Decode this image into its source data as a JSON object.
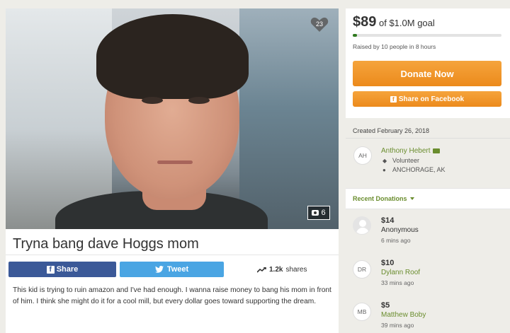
{
  "campaign": {
    "title": "Tryna bang dave Hoggs mom",
    "hearts": "23",
    "photo_count": "6",
    "story": "This kid is trying to ruin amazon and I've had enough. I wanna raise money to bang his mom in front of him. I think she might do it for a cool mill, but every dollar goes toward supporting the dream."
  },
  "share": {
    "facebook_label": "Share",
    "twitter_label": "Tweet",
    "shares_count": "1.2k",
    "shares_label": "shares"
  },
  "goal": {
    "raised": "$89",
    "goal_text": "of $1.0M goal",
    "raised_by": "Raised by 10 people in 8 hours",
    "progress_percent": 3,
    "donate_label": "Donate Now",
    "fb_share_label": "Share on Facebook"
  },
  "organizer": {
    "created": "Created February 26, 2018",
    "initials": "AH",
    "name": "Anthony Hebert",
    "role": "Volunteer",
    "location": "ANCHORAGE, AK"
  },
  "recent": {
    "label": "Recent Donations",
    "items": [
      {
        "amount": "$14",
        "name": "Anonymous",
        "time": "6 mins ago",
        "initials": ""
      },
      {
        "amount": "$10",
        "name": "Dylann Roof",
        "time": "33 mins ago",
        "initials": "DR"
      },
      {
        "amount": "$5",
        "name": "Matthew Boby",
        "time": "39 mins ago",
        "initials": "MB"
      }
    ]
  },
  "colors": {
    "accent_green": "#6a8d2e",
    "donate_orange": "#ec8a1c",
    "facebook_blue": "#3b5998",
    "twitter_blue": "#4aa5e3"
  }
}
